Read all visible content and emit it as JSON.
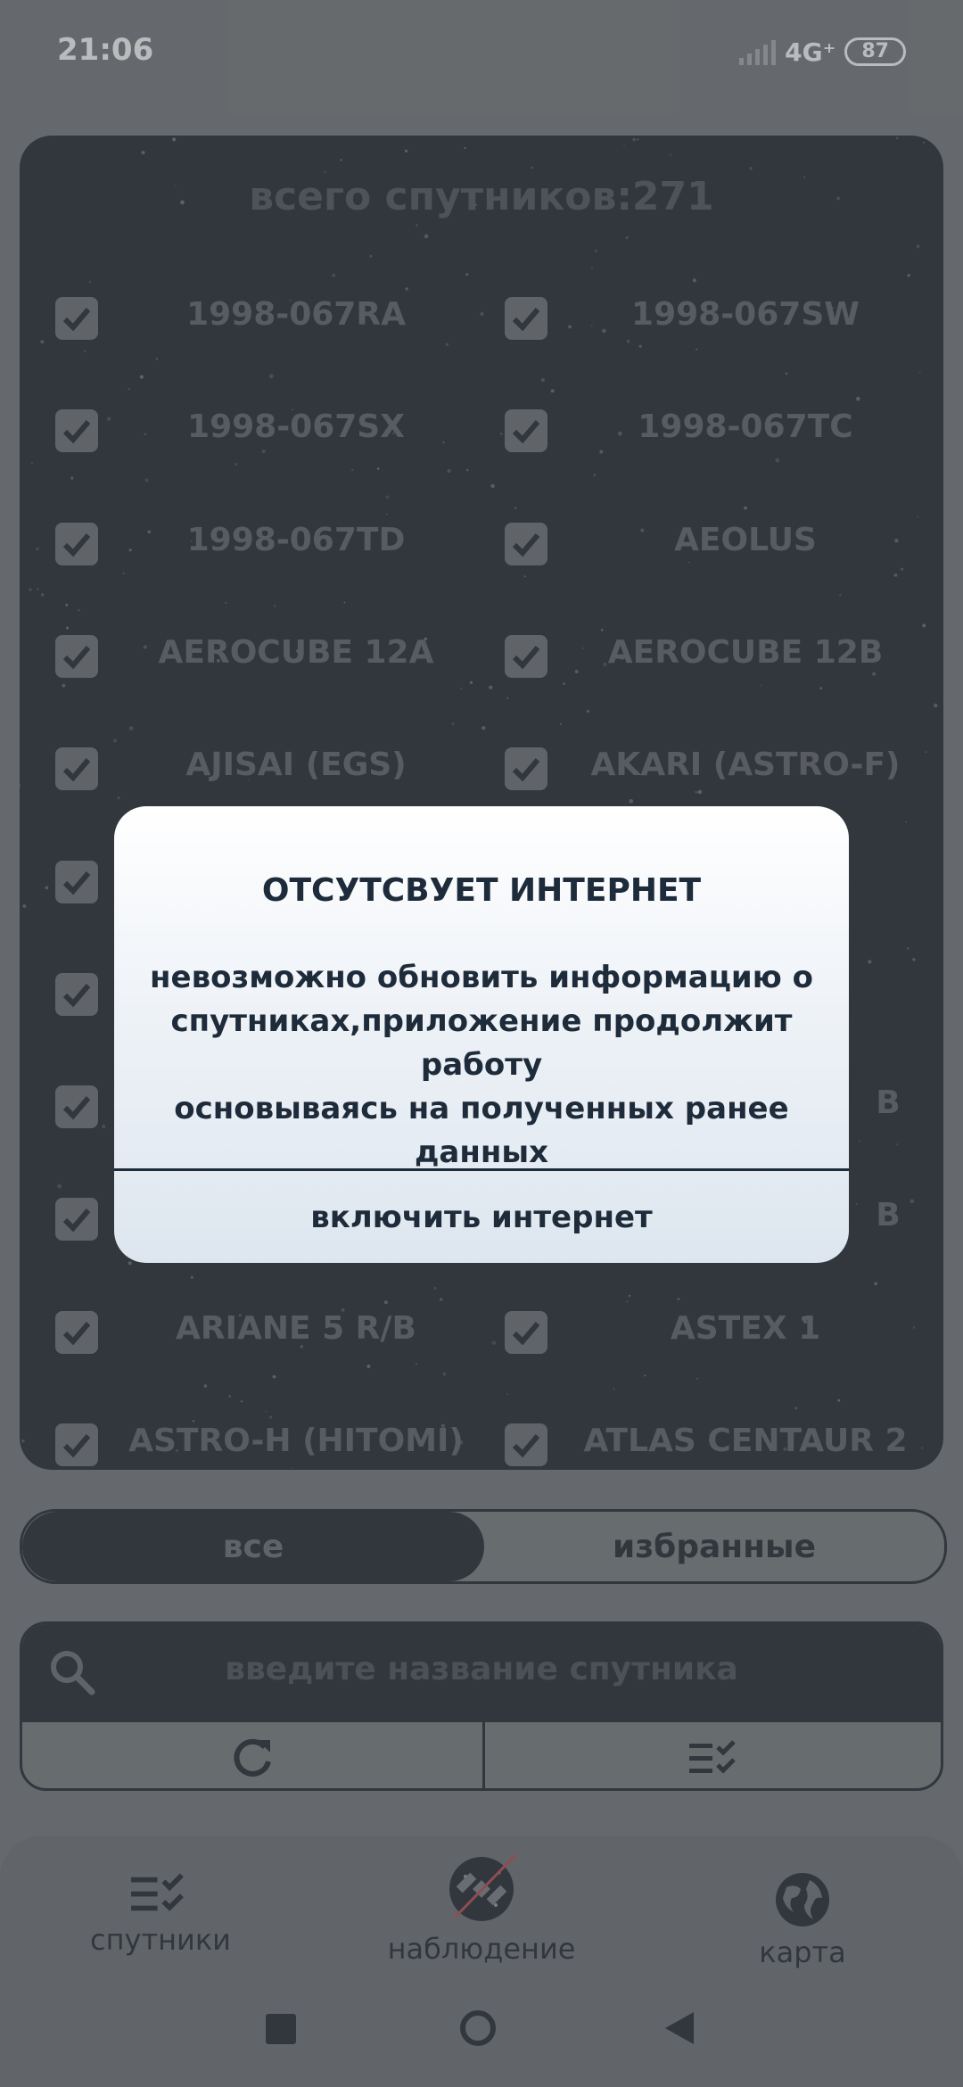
{
  "status_bar": {
    "time": "21:06",
    "network": "4G⁺",
    "battery": "87"
  },
  "satellites_panel": {
    "title": "всего спутников:271",
    "items": [
      {
        "name": "1998-067RA",
        "checked": true
      },
      {
        "name": "1998-067SW",
        "checked": true
      },
      {
        "name": "1998-067SX",
        "checked": true
      },
      {
        "name": "1998-067TC",
        "checked": true
      },
      {
        "name": "1998-067TD",
        "checked": true
      },
      {
        "name": "AEOLUS",
        "checked": true
      },
      {
        "name": "AEROCUBE 12A",
        "checked": true
      },
      {
        "name": "AEROCUBE 12B",
        "checked": true
      },
      {
        "name": "AJISAI (EGS)",
        "checked": true
      },
      {
        "name": "AKARI (ASTRO-F)",
        "checked": true
      },
      {
        "name": "",
        "checked": true
      },
      {
        "name": "",
        "checked": false
      },
      {
        "name": "",
        "checked": true
      },
      {
        "name": "",
        "checked": false
      },
      {
        "name": "",
        "checked": true
      },
      {
        "name": "B",
        "checked": false
      },
      {
        "name": "",
        "checked": true
      },
      {
        "name": "B",
        "checked": false
      },
      {
        "name": "ARIANE 5 R/B",
        "checked": true
      },
      {
        "name": "ASTEX 1",
        "checked": true
      },
      {
        "name": "ASTRO-H (HITOMI)",
        "checked": true
      },
      {
        "name": "ATLAS CENTAUR 2",
        "checked": true
      }
    ]
  },
  "filter_tabs": {
    "all": "все",
    "favorites": "избранные",
    "selected": "all"
  },
  "search": {
    "placeholder": "введите название спутника"
  },
  "actions": {
    "refresh_icon": "refresh-icon",
    "select_icon": "checklist-icon"
  },
  "bottom_nav": {
    "items": [
      {
        "label": "спутники",
        "icon": "checklist-icon"
      },
      {
        "label": "наблюдение",
        "icon": "satellite-icon"
      },
      {
        "label": "карта",
        "icon": "globe-icon"
      }
    ]
  },
  "dialog": {
    "title": "ОТСУТСВУЕТ ИНТЕРНЕТ",
    "message_lines": [
      "невозможно обновить информацию о",
      "спутниках,приложение продолжит работу",
      "основываясь на полученных ранее данных"
    ],
    "button": "включить интернет"
  },
  "colors": {
    "panel_dark": "#0a1017",
    "overlay_gray": "#676b6e",
    "dialog_text": "#1e2b3a"
  }
}
